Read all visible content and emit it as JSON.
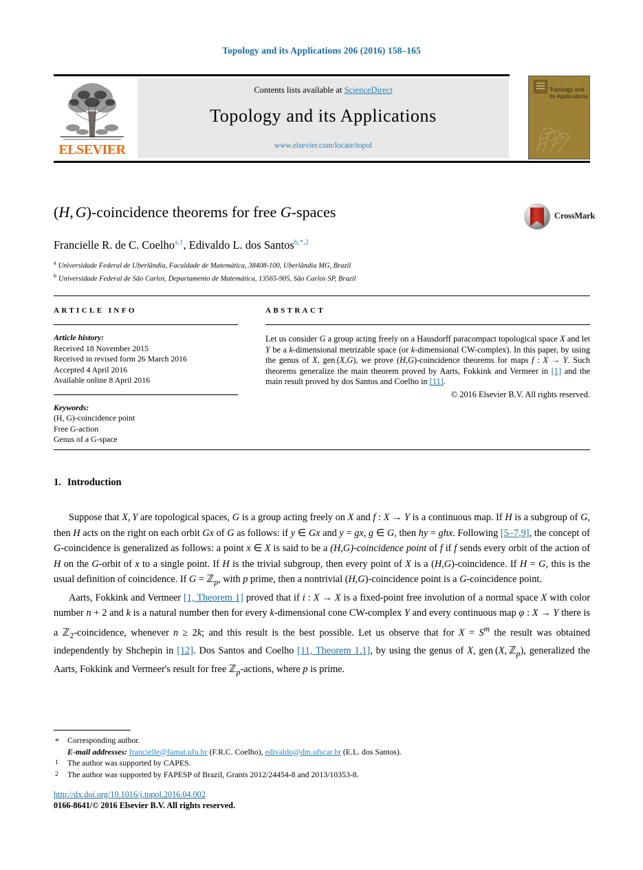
{
  "running_head": "Topology and its Applications 206 (2016) 158–165",
  "masthead": {
    "contents_prefix": "Contents lists available at ",
    "sciencedirect": "ScienceDirect",
    "journal_title": "Topology and its Applications",
    "journal_url": "www.elsevier.com/locate/topol",
    "publisher_wordmark": "ELSEVIER",
    "cover_title": "Topology and its Applications"
  },
  "article": {
    "title": "(H, G)-coincidence theorems for free G-spaces",
    "crossmark_label": "CrossMark",
    "authors": "Francielle R. de C. Coelho, Edivaldo L. dos Santos",
    "author_1_name": "Francielle R. de C. Coelho",
    "author_1_marks": "a,1",
    "author_2_name": "Edivaldo L. dos Santos",
    "author_2_marks": "b,*,2",
    "affiliations": [
      {
        "marker": "a",
        "text": "Universidade Federal de Uberlândia, Faculdade de Matemática, 38408-100, Uberlândia MG, Brazil"
      },
      {
        "marker": "b",
        "text": "Universidade Federal de São Carlos, Departamento de Matemática, 13565-905, São Carlos SP, Brazil"
      }
    ]
  },
  "info": {
    "heading": "ARTICLE INFO",
    "history_label": "Article history:",
    "history": [
      "Received 18 November 2015",
      "Received in revised form 26 March 2016",
      "Accepted 4 April 2016",
      "Available online 8 April 2016"
    ],
    "keywords_label": "Keywords:",
    "keywords": [
      "(H, G)-coincidence point",
      "Free G-action",
      "Genus of a G-space"
    ]
  },
  "abstract": {
    "heading": "ABSTRACT",
    "text_part_1": "Let us consider ",
    "text_part_2": " a group acting freely on a Hausdorff paracompact topological space ",
    "text_part_3": " and let ",
    "text_part_4": " be a ",
    "text_part_5": "-dimensional metrizable space (or ",
    "text_part_6": "-dimensional CW-complex). In this paper, by using the genus of ",
    "text_part_7": ", gen",
    "text_part_8": ", we prove ",
    "text_part_9": "-coincidence theorems for maps ",
    "text_part_10": ". Such theorems generalize the main theorem proved by Aarts, Fokkink and Vermeer in ",
    "ref_1": "[1]",
    "text_part_11": " and the main result proved by dos Santos and Coelho in ",
    "ref_11": "[11]",
    "text_part_12": ".",
    "copyright": "© 2016 Elsevier B.V. All rights reserved."
  },
  "introduction": {
    "number": "1.",
    "title": "Introduction",
    "para1_a": "Suppose that ",
    "para1_b": " are topological spaces, ",
    "para1_c": " is a group acting freely on ",
    "para1_d": " and ",
    "para1_e": " is a continuous map. If ",
    "para1_f": " is a subgroup of ",
    "para1_g": ", then ",
    "para1_h": " acts on the right on each orbit ",
    "para1_i": " of ",
    "para1_j": " as follows: if ",
    "para1_k": " and ",
    "para1_l": ", ",
    "para1_m": ", then ",
    "para1_n": ". Following ",
    "ref_5_7_9": "[5–7,9]",
    "para1_o": ", the concept of ",
    "para1_p": "-coincidence is generalized as follows: a point ",
    "para1_q": " is said to be a ",
    "para1_r": "-coincidence point",
    "para1_s": " of ",
    "para1_t": " if ",
    "para1_u": " sends every orbit of the action of ",
    "para1_v": " on the ",
    "para1_w": "-orbit of ",
    "para1_x": " to a single point. If ",
    "para1_y": " is the trivial subgroup, then every point of ",
    "para1_z": " is a ",
    "para1_aa": "-coincidence. If ",
    "para1_ab": ", this is the usual definition of coincidence. If ",
    "para1_ac": ", with ",
    "para1_ad": " prime, then a nontrivial ",
    "para1_ae": "-coincidence point is a ",
    "para1_af": "-coincidence point.",
    "para2_a": "Aarts, Fokkink and Vermeer ",
    "ref_1_thm": "[1, Theorem 1]",
    "para2_b": " proved that if ",
    "para2_c": " is a fixed-point free involution of a normal space ",
    "para2_d": " with color number ",
    "para2_e": " and ",
    "para2_f": " is a natural number then for every ",
    "para2_g": "-dimensional cone CW-complex ",
    "para2_h": " and every continuous map ",
    "para2_i": " there is a ",
    "para2_j": "-coincidence, whenever ",
    "para2_k": "; and this result is the best possible. Let us observe that for ",
    "para2_l": " the result was obtained independently by Shchepin in ",
    "ref_12": "[12]",
    "para2_m": ". Dos Santos and Coelho ",
    "ref_11_thm": "[11, Theorem 1.1]",
    "para2_n": ", by using the genus of ",
    "para2_o": ", gen",
    "para2_p": ", generalized the Aarts, Fokkink and Vermeer's result for free ",
    "para2_q": "-actions, where ",
    "para2_r": " is prime."
  },
  "footnotes": {
    "corresponding": "Corresponding author.",
    "corresponding_mark": "*",
    "email_label": "E-mail addresses:",
    "email_1": "francielle@famat.ufu.br",
    "email_1_owner": "(F.R.C. Coelho),",
    "email_2": "edivaldo@dm.ufscar.br",
    "email_2_owner": "(E.L. dos Santos).",
    "note_1_mark": "1",
    "note_1": "The author was supported by CAPES.",
    "note_2_mark": "2",
    "note_2": "The author was supported by FAPESP of Brazil, Grants 2012/24454-8 and 2013/10353-8."
  },
  "footer": {
    "doi": "http://dx.doi.org/10.1016/j.topol.2016.04.002",
    "issn_line": "0166-8641/© 2016 Elsevier B.V. All rights reserved."
  },
  "colors": {
    "link_blue": "#2a7fb8",
    "head_blue": "#1a6b9c",
    "elsevier_orange": "#e86c1a",
    "cover_gold": "#9d8136",
    "panel_grey": "#e8e8e8"
  }
}
